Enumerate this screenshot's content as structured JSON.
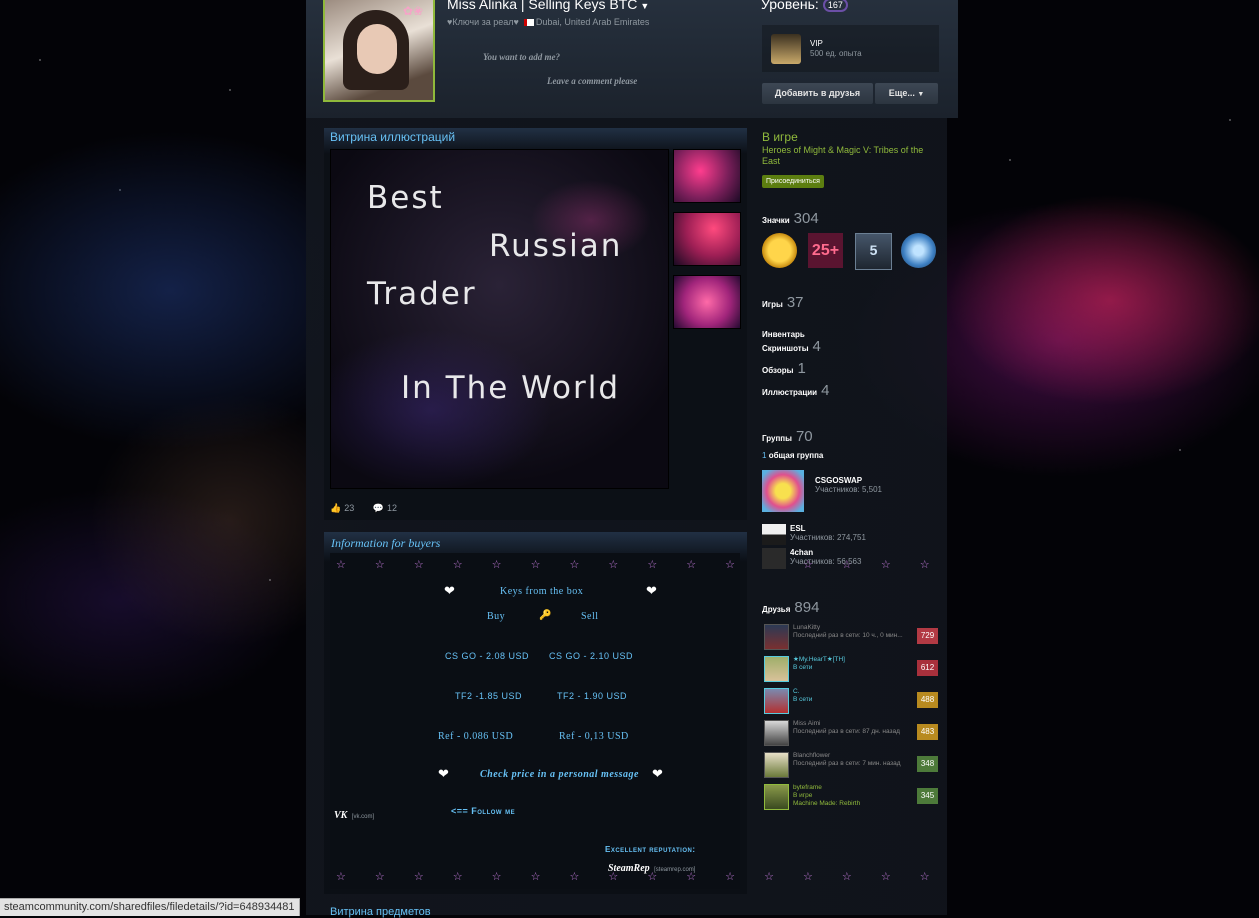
{
  "profile": {
    "name": "Miss Alinka | Selling Keys BTC",
    "realname_line": "♥Ключи за реал♥",
    "location": "Dubai, United Arab Emirates",
    "summary_line1": "You want to add me?",
    "summary_line2": "Leave a comment please"
  },
  "level": {
    "label": "Уровень:",
    "value": "167"
  },
  "featured_badge": {
    "title": "VIP",
    "xp": "500 ед. опыта"
  },
  "buttons": {
    "add_friend": "Добавить в друзья",
    "more": "Еще..."
  },
  "artwork_showcase": {
    "title": "Витрина иллюстраций",
    "art_lines": [
      "Best",
      "Russian",
      "Trader",
      "In The World"
    ],
    "likes": "23",
    "comments": "12"
  },
  "info_box": {
    "title": "Information for buyers",
    "sparkles": "☆ ☆ ☆ ☆ ☆ ☆ ☆ ☆ ☆ ☆ ☆ ☆ ☆ ☆ ☆ ☆",
    "heart": "❤",
    "keys_from_box": "Keys from the box",
    "buy": "Buy",
    "sell": "Sell",
    "key_icon": "🔑",
    "rows": [
      {
        "buy": "CS GO - 2.08 USD",
        "sell": "CS GO - 2.10 USD"
      },
      {
        "buy": "TF2 -1.85 USD",
        "sell": "TF2 - 1.90 USD"
      },
      {
        "buy": "Ref - 0.086 USD",
        "sell": "Ref - 0,13 USD"
      }
    ],
    "check_price": "Check price in a personal message",
    "vk": "VK",
    "vk_domain": "[vk.com]",
    "follow_me": "<== Follow me",
    "excellent_reputation": "Excellent reputation:",
    "steamrep": "SteamRep",
    "steamrep_domain": "[steamrep.com]"
  },
  "next_showcase_title": "Витрина предметов",
  "right_column": {
    "ingame_label": "В игре",
    "ingame_game": "Heroes of Might & Magic V: Tribes of the East",
    "join_button": "Присоединиться",
    "badges": {
      "label": "Значки",
      "count": "304",
      "badge2_text": "25+",
      "badge3_text": "5"
    },
    "stats": [
      {
        "label": "Игры",
        "value": "37"
      },
      {
        "label": "Инвентарь",
        "value": ""
      },
      {
        "label": "Скриншоты",
        "value": "4"
      },
      {
        "label": "Обзоры",
        "value": "1"
      },
      {
        "label": "Иллюстрации",
        "value": "4"
      }
    ],
    "groups": {
      "label": "Группы",
      "count": "70",
      "common_count": "1",
      "common_label": "общая группа",
      "list": [
        {
          "name": "CSGOSWAP",
          "members": "Участников: 5,501"
        },
        {
          "name": "ESL",
          "members": "Участников: 274,751"
        },
        {
          "name": "4chan",
          "members": "Участников: 56,563"
        }
      ]
    },
    "friends": {
      "label": "Друзья",
      "count": "894",
      "list": [
        {
          "name": "LunaKitty",
          "status": "Последний раз в сети: 10 ч., 0 мин...",
          "level": "729",
          "state": "offline",
          "extra": ""
        },
        {
          "name": "★My.HearT★[TH]",
          "status": "В сети",
          "level": "612",
          "state": "online",
          "extra": ""
        },
        {
          "name": "C.",
          "status": "В сети",
          "level": "488",
          "state": "online",
          "extra": ""
        },
        {
          "name": "Miss Aimi",
          "status": "Последний раз в сети: 87 дн. назад",
          "level": "483",
          "state": "offline",
          "extra": ""
        },
        {
          "name": "Blanchflower",
          "status": "Последний раз в сети: 7 мин. назад",
          "level": "348",
          "state": "offline",
          "extra": ""
        },
        {
          "name": "byteframe",
          "status": "В игре",
          "level": "345",
          "state": "ingame",
          "extra": "Machine Made: Rebirth"
        }
      ]
    }
  },
  "browser_status_url": "steamcommunity.com/sharedfiles/filedetails/?id=648934481",
  "colors": {
    "link_blue": "#67c1f5",
    "ingame_green": "#90ba3c",
    "online_blue": "#57cbde",
    "offline_grey": "#898989"
  },
  "icons": {
    "thumbs_up": "thumbs-up-icon",
    "comment": "comment-icon",
    "dropdown": "chevron-down-icon"
  }
}
